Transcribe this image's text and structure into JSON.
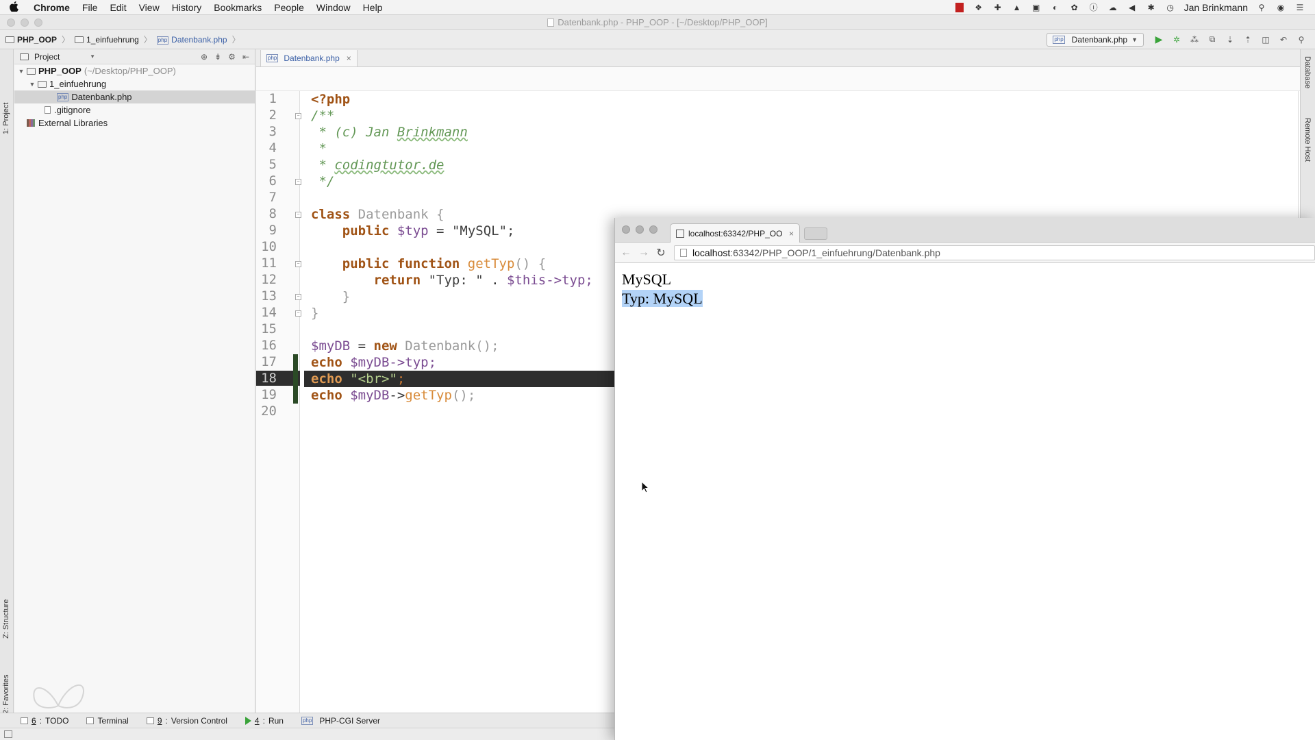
{
  "menubar": {
    "apple": "",
    "app": "Chrome",
    "items": [
      "File",
      "Edit",
      "View",
      "History",
      "Bookmarks",
      "People",
      "Window",
      "Help"
    ],
    "user": "Jan Brinkmann"
  },
  "window": {
    "title": "Datenbank.php - PHP_OOP - [~/Desktop/PHP_OOP]"
  },
  "breadcrumb": [
    "PHP_OOP",
    "1_einfuehrung",
    "Datenbank.php"
  ],
  "run_config": "Datenbank.php",
  "project": {
    "dropdown": "Project",
    "tree": [
      {
        "label": "PHP_OOP",
        "path": "(~/Desktop/PHP_OOP)"
      },
      {
        "label": "1_einfuehrung"
      },
      {
        "label": "Datenbank.php"
      },
      {
        "label": ".gitignore"
      },
      {
        "label": "External Libraries"
      }
    ]
  },
  "left_tabs": {
    "project": "1: Project",
    "structure": "Z: Structure",
    "favorites": "2: Favorites"
  },
  "right_tabs": {
    "database": "Database",
    "remote": "Remote Host"
  },
  "editor": {
    "tab": "Datenbank.php",
    "line_numbers": [
      "1",
      "2",
      "3",
      "4",
      "5",
      "6",
      "7",
      "8",
      "9",
      "10",
      "11",
      "12",
      "13",
      "14",
      "15",
      "16",
      "17",
      "18",
      "19",
      "20"
    ],
    "code": {
      "l1": "<?php",
      "l2": "/**",
      "l3a": " * (c) Jan ",
      "l3b": "Brinkmann",
      "l4": " *",
      "l5a": " * ",
      "l5b": "codingtutor.de",
      "l6": " */",
      "l8a": "class ",
      "l8b": "Datenbank {",
      "l9a": "    public ",
      "l9b": "$typ",
      "l9c": " = ",
      "l9d": "\"MySQL\";",
      "l11a": "    public function ",
      "l11b": "getTyp",
      "l11c": "() {",
      "l12a": "        return ",
      "l12b": "\"Typ: \"",
      "l12c": " . ",
      "l12d": "$this",
      "l12e": "->typ;",
      "l13": "    }",
      "l14": "}",
      "l16a": "$myDB",
      "l16b": " = ",
      "l16c": "new ",
      "l16d": "Datenbank();",
      "l17a": "echo ",
      "l17b": "$myDB",
      "l17c": "->typ;",
      "l18a": "echo ",
      "l18b": "\"<br>\"",
      "l18c": ";",
      "l19a": "echo ",
      "l19b": "$myDB",
      "l19c": "->",
      "l19d": "getTyp",
      "l19e": "();"
    },
    "current_line": 18
  },
  "bottom_tools": [
    {
      "num": "6",
      "label": "TODO"
    },
    {
      "label": "Terminal"
    },
    {
      "num": "9",
      "label": "Version Control"
    },
    {
      "num": "4",
      "label": "Run"
    },
    {
      "label": "PHP-CGI Server"
    }
  ],
  "browser": {
    "tab_title": "localhost:63342/PHP_OO",
    "url_host": "localhost",
    "url_rest": ":63342/PHP_OOP/1_einfuehrung/Datenbank.php",
    "output_line1": "MySQL",
    "output_line2": "Typ: MySQL"
  },
  "colors": {
    "keyword": "#a05315",
    "comment": "#629755",
    "current_line_bg": "#2e2e2e",
    "selection": "#b3d3f7",
    "run_green": "#3aa33a"
  }
}
